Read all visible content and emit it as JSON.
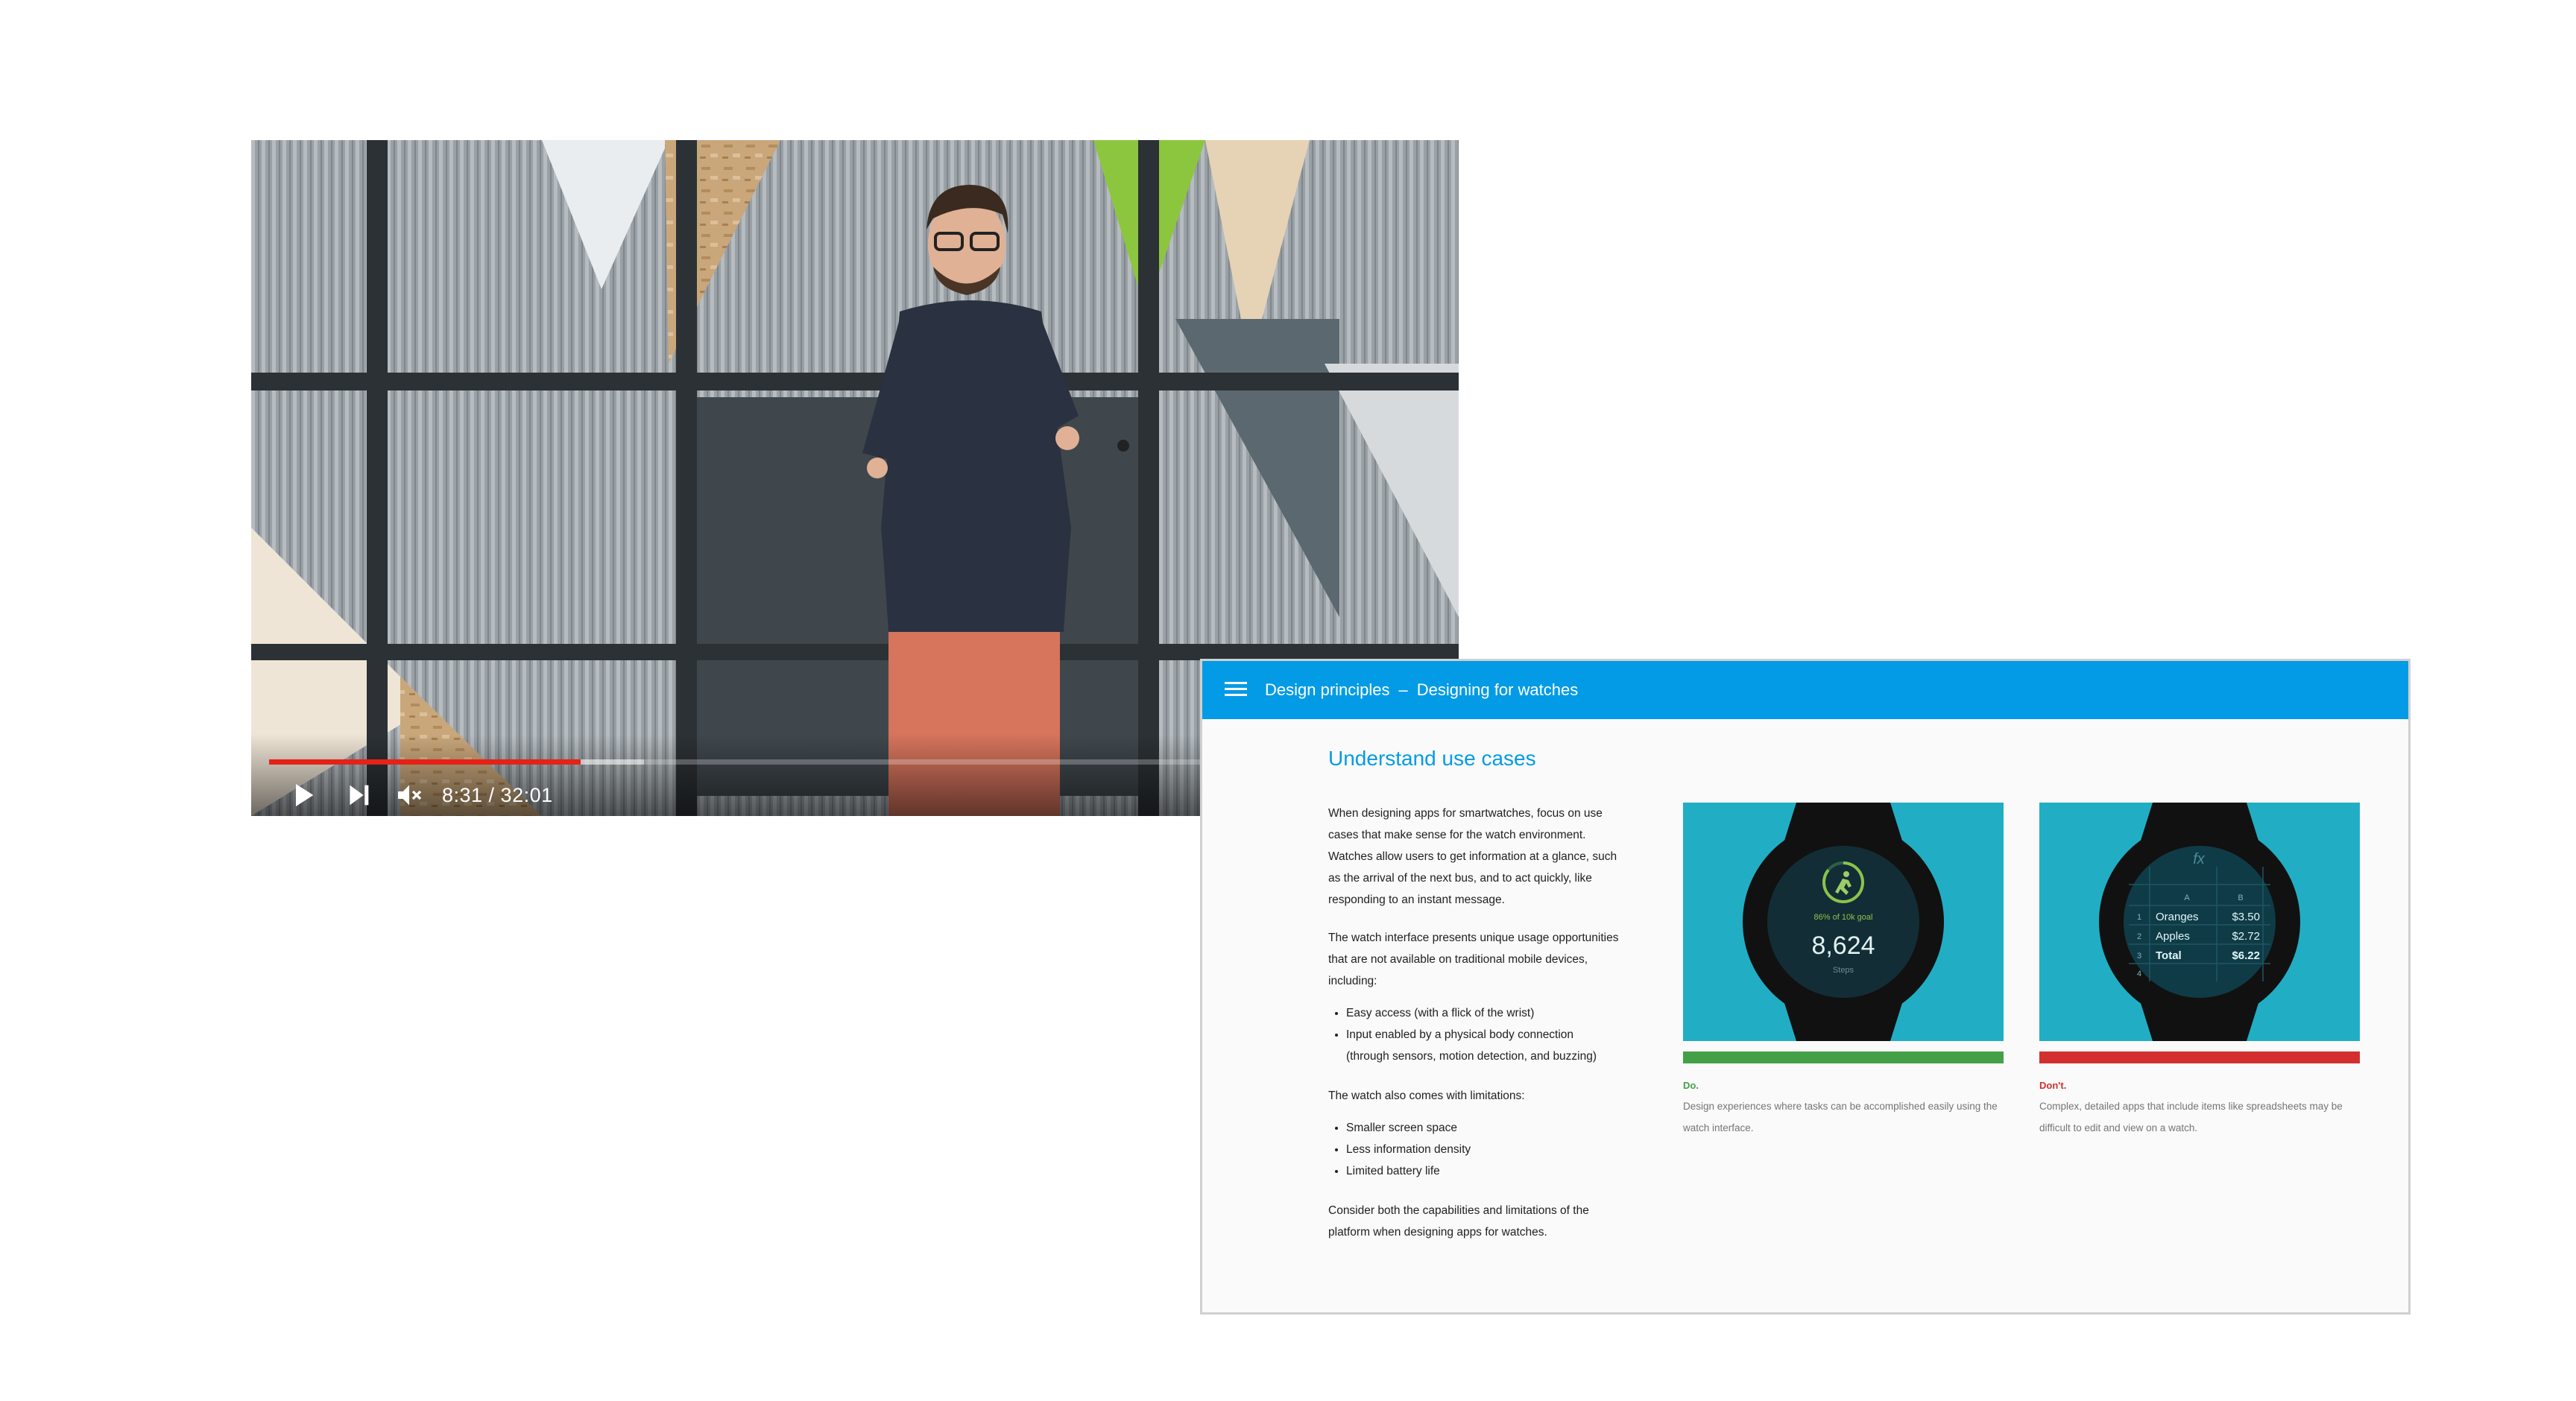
{
  "video": {
    "time_display": "8:31 / 32:01",
    "progress_played_percent": 26.6,
    "progress_buffered_percent": 32,
    "colors": {
      "progress": "#e62117"
    },
    "controls": {
      "play_icon": "play-icon",
      "next_icon": "skip-next-icon",
      "mute_icon": "volume-muted-icon"
    }
  },
  "page": {
    "appbar": {
      "section": "Design principles",
      "separator": "–",
      "page": "Designing for watches",
      "color": "#039be5"
    },
    "heading": "Understand use cases",
    "intro": "When designing apps for smartwatches, focus on use cases that make sense for the watch environment. Watches allow users to get information at a glance, such as the arrival of the next bus, and to act quickly, like responding to an instant message.",
    "opportunities_intro": "The watch interface presents unique usage opportunities that are not available on traditional mobile devices, including:",
    "opportunities": [
      "Easy access (with a flick of the wrist)",
      "Input enabled by a physical body connection (through sensors, motion detection, and buzzing)"
    ],
    "limitations_intro": "The watch also comes with limitations:",
    "limitations": [
      "Smaller screen space",
      "Less information density",
      "Limited battery life"
    ],
    "conclusion": "Consider both the capabilities and limitations of the platform when designing apps for watches.",
    "do_card": {
      "label": "Do.",
      "caption": "Design experiences where tasks can be accomplished easily using the watch interface.",
      "color": "#43a047",
      "watch": {
        "goal_text": "86% of 10k goal",
        "steps_value": "8,624",
        "steps_label": "Steps",
        "goal_fraction": 0.86
      }
    },
    "dont_card": {
      "label": "Don't.",
      "caption": "Complex, detailed apps that include items like spreadsheets may be difficult to edit and view on a watch.",
      "color": "#d32f2f",
      "watch": {
        "formula_symbol": "fx",
        "columns": [
          "A",
          "B"
        ],
        "rows": [
          {
            "num": "1",
            "a": "Oranges",
            "b": "$3.50"
          },
          {
            "num": "2",
            "a": "Apples",
            "b": "$2.72"
          },
          {
            "num": "3",
            "a": "Total",
            "b": "$6.22"
          },
          {
            "num": "4",
            "a": "",
            "b": ""
          }
        ]
      }
    }
  }
}
